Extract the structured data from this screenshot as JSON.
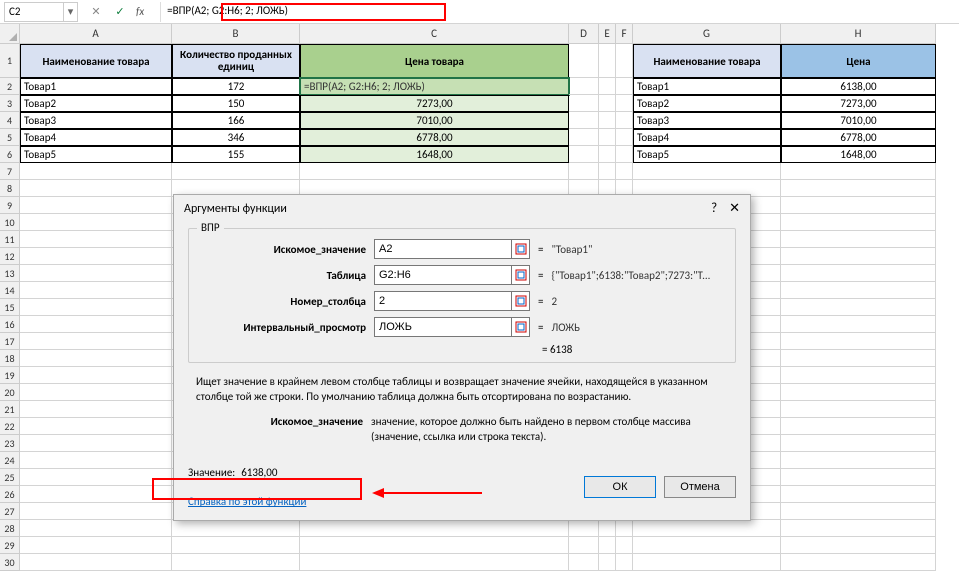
{
  "name_box": "C2",
  "formula": "=ВПР(A2; G2:H6; 2; ЛОЖЬ)",
  "columns": [
    "A",
    "B",
    "C",
    "D",
    "E",
    "F",
    "G",
    "H"
  ],
  "row_nums": [
    1,
    2,
    3,
    4,
    5,
    6,
    7,
    8,
    9,
    10,
    11,
    12,
    13,
    14,
    15,
    16,
    17,
    18,
    19,
    20,
    21,
    22,
    23,
    24,
    25,
    26,
    27,
    28,
    29,
    30
  ],
  "headers": {
    "A": "Наименование товара",
    "B": "Количество проданных единиц",
    "C": "Цена товара",
    "G": "Наименование товара",
    "H": "Цена"
  },
  "table1": [
    {
      "name": "Товар1",
      "qty": "172",
      "price": "=ВПР(A2; G2:H6; 2; ЛОЖЬ)"
    },
    {
      "name": "Товар2",
      "qty": "150",
      "price": "7273,00"
    },
    {
      "name": "Товар3",
      "qty": "166",
      "price": "7010,00"
    },
    {
      "name": "Товар4",
      "qty": "346",
      "price": "6778,00"
    },
    {
      "name": "Товар5",
      "qty": "155",
      "price": "1648,00"
    }
  ],
  "table2": [
    {
      "name": "Товар1",
      "price": "6138,00"
    },
    {
      "name": "Товар2",
      "price": "7273,00"
    },
    {
      "name": "Товар3",
      "price": "7010,00"
    },
    {
      "name": "Товар4",
      "price": "6778,00"
    },
    {
      "name": "Товар5",
      "price": "1648,00"
    }
  ],
  "dialog": {
    "title": "Аргументы функции",
    "group": "ВПР",
    "args": [
      {
        "label": "Искомое_значение",
        "value": "A2",
        "result": "\"Товар1\""
      },
      {
        "label": "Таблица",
        "value": "G2:H6",
        "result": "{\"Товар1\";6138:\"Товар2\";7273:\"Т..."
      },
      {
        "label": "Номер_столбца",
        "value": "2",
        "result": "2"
      },
      {
        "label": "Интервальный_просмотр",
        "value": "ЛОЖЬ",
        "result": "ЛОЖЬ"
      }
    ],
    "equals_result": "= 6138",
    "description": "Ищет значение в крайнем левом столбце таблицы и возвращает значение ячейки, находящейся в указанном столбце той же строки. По умолчанию таблица должна быть отсортирована по возрастанию.",
    "arg_name": "Искомое_значение",
    "arg_desc": "значение, которое должно быть найдено в первом столбце массива (значение, ссылка или строка текста).",
    "value_label": "Значение:",
    "value": "6138,00",
    "help_link": "Справка по этой функции",
    "ok": "ОК",
    "cancel": "Отмена"
  }
}
